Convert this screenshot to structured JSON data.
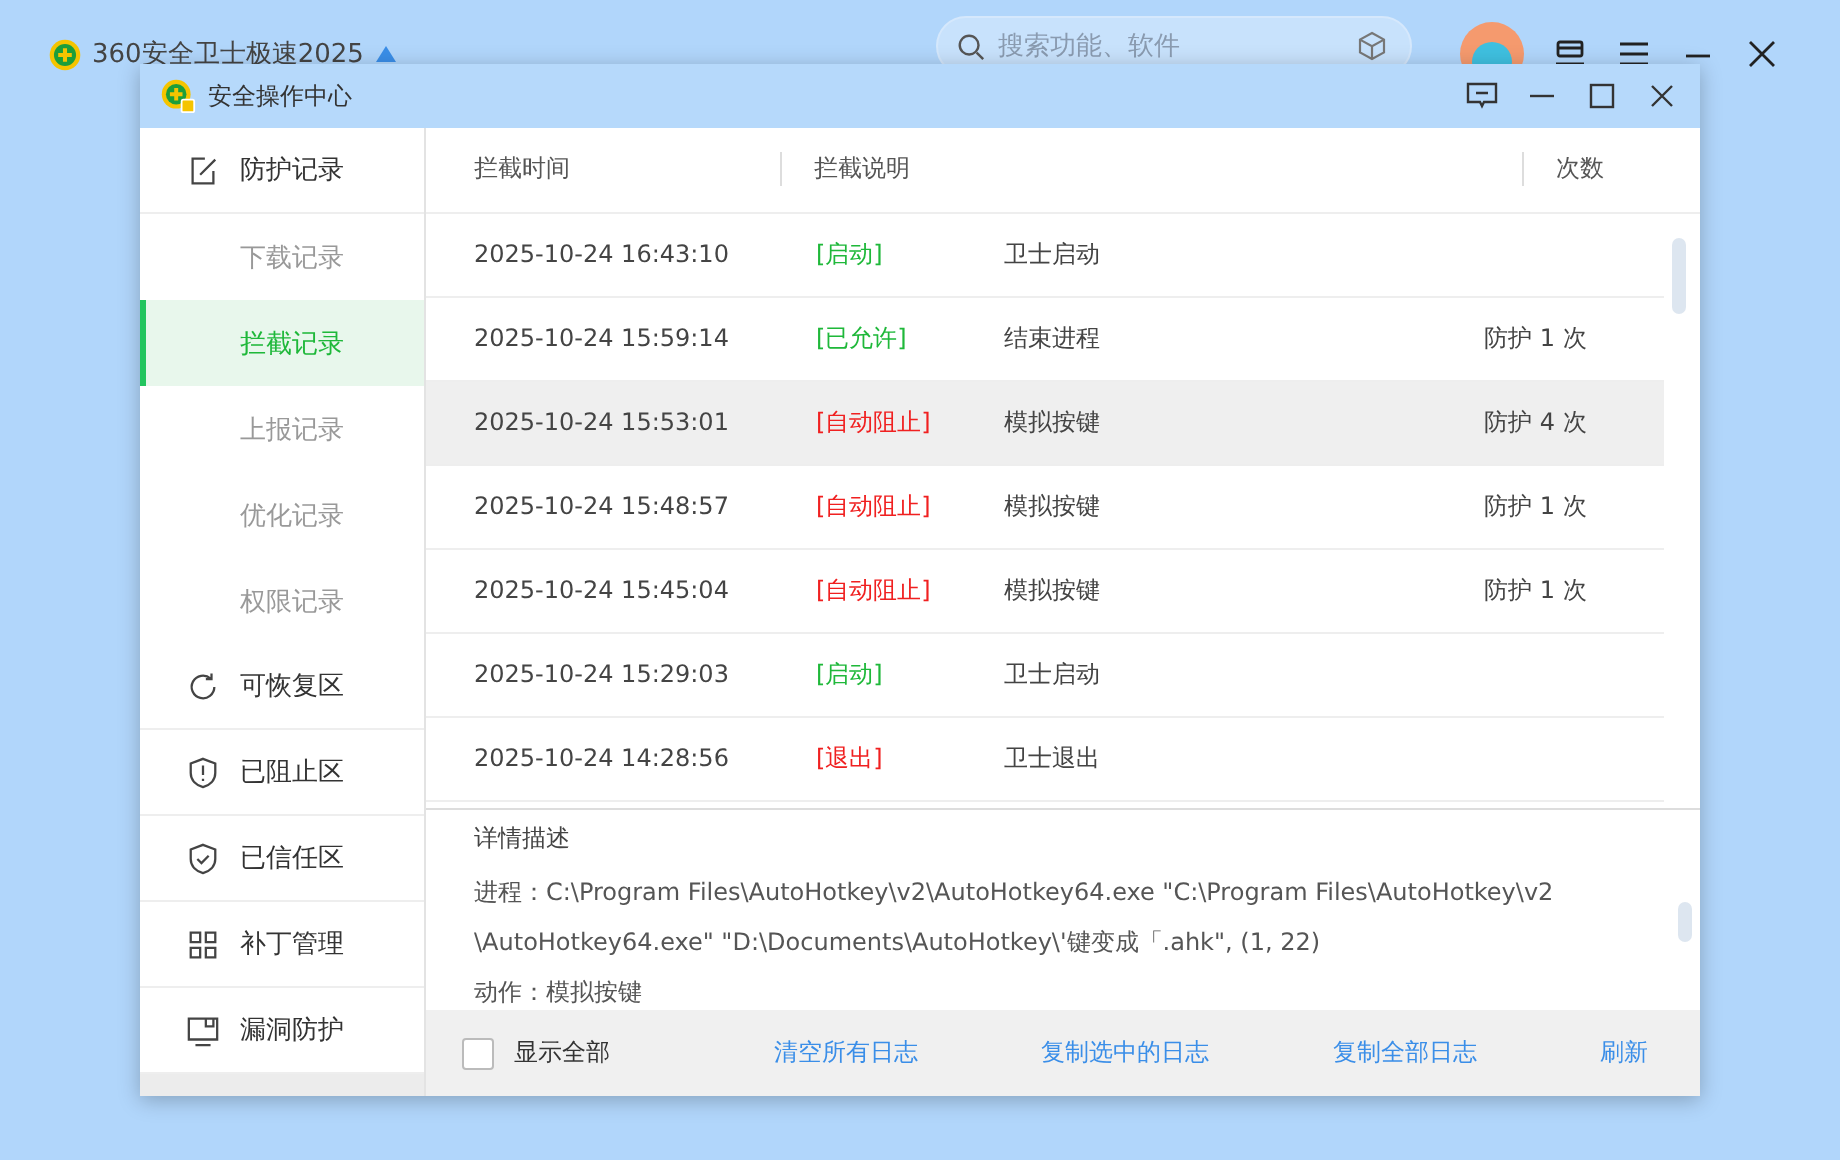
{
  "app": {
    "title": "360安全卫士极速2025",
    "search": {
      "placeholder": "搜索功能、软件"
    }
  },
  "window": {
    "title": "安全操作中心"
  },
  "sidebar": {
    "items": [
      {
        "label": "防护记录",
        "kind": "section",
        "selected": false
      },
      {
        "label": "下载记录",
        "kind": "sub",
        "selected": false
      },
      {
        "label": "拦截记录",
        "kind": "sub",
        "selected": true
      },
      {
        "label": "上报记录",
        "kind": "sub",
        "selected": false
      },
      {
        "label": "优化记录",
        "kind": "sub",
        "selected": false
      },
      {
        "label": "权限记录",
        "kind": "sub",
        "selected": false
      },
      {
        "label": "可恢复区",
        "kind": "section",
        "selected": false
      },
      {
        "label": "已阻止区",
        "kind": "section",
        "selected": false
      },
      {
        "label": "已信任区",
        "kind": "section",
        "selected": false
      },
      {
        "label": "补丁管理",
        "kind": "section",
        "selected": false
      },
      {
        "label": "漏洞防护",
        "kind": "section",
        "selected": false
      }
    ]
  },
  "table": {
    "columns": [
      "拦截时间",
      "拦截说明",
      "次数"
    ],
    "rows": [
      {
        "time": "2025-10-24 16:43:10",
        "status": "[启动]",
        "color": "#1fb83a",
        "description": "卫士启动",
        "selected": false
      },
      {
        "time": "2025-10-24 15:59:14",
        "status": "[已允许]",
        "color": "#1fb83a",
        "description": "结束进程",
        "count": "防护 1 次",
        "selected": false
      },
      {
        "time": "2025-10-24 15:53:01",
        "status": "[自动阻止]",
        "color": "#f02020",
        "description": "模拟按键",
        "count": "防护 4 次",
        "selected": true
      },
      {
        "time": "2025-10-24 15:48:57",
        "status": "[自动阻止]",
        "color": "#f02020",
        "description": "模拟按键",
        "count": "防护 1 次",
        "selected": false
      },
      {
        "time": "2025-10-24 15:45:04",
        "status": "[自动阻止]",
        "color": "#f02020",
        "description": "模拟按键",
        "count": "防护 1 次",
        "selected": false
      },
      {
        "time": "2025-10-24 15:29:03",
        "status": "[启动]",
        "color": "#1fb83a",
        "description": "卫士启动",
        "selected": false
      },
      {
        "time": "2025-10-24 14:28:56",
        "status": "[退出]",
        "color": "#f02020",
        "description": "卫士退出",
        "selected": false
      }
    ]
  },
  "details": {
    "title": "详情描述",
    "lines": [
      "进程：C:\\Program Files\\AutoHotkey\\v2\\AutoHotkey64.exe \"C:\\Program Files\\AutoHotkey\\v2",
      "\\AutoHotkey64.exe\" \"D:\\Documents\\AutoHotkey\\'键变成「.ahk\", (1, 22)",
      "动作：模拟按键"
    ]
  },
  "footer": {
    "show_all": {
      "label": "显示全部",
      "checked": false
    },
    "actions": [
      "清空所有日志",
      "复制选中的日志",
      "复制全部日志",
      "刷新"
    ]
  }
}
